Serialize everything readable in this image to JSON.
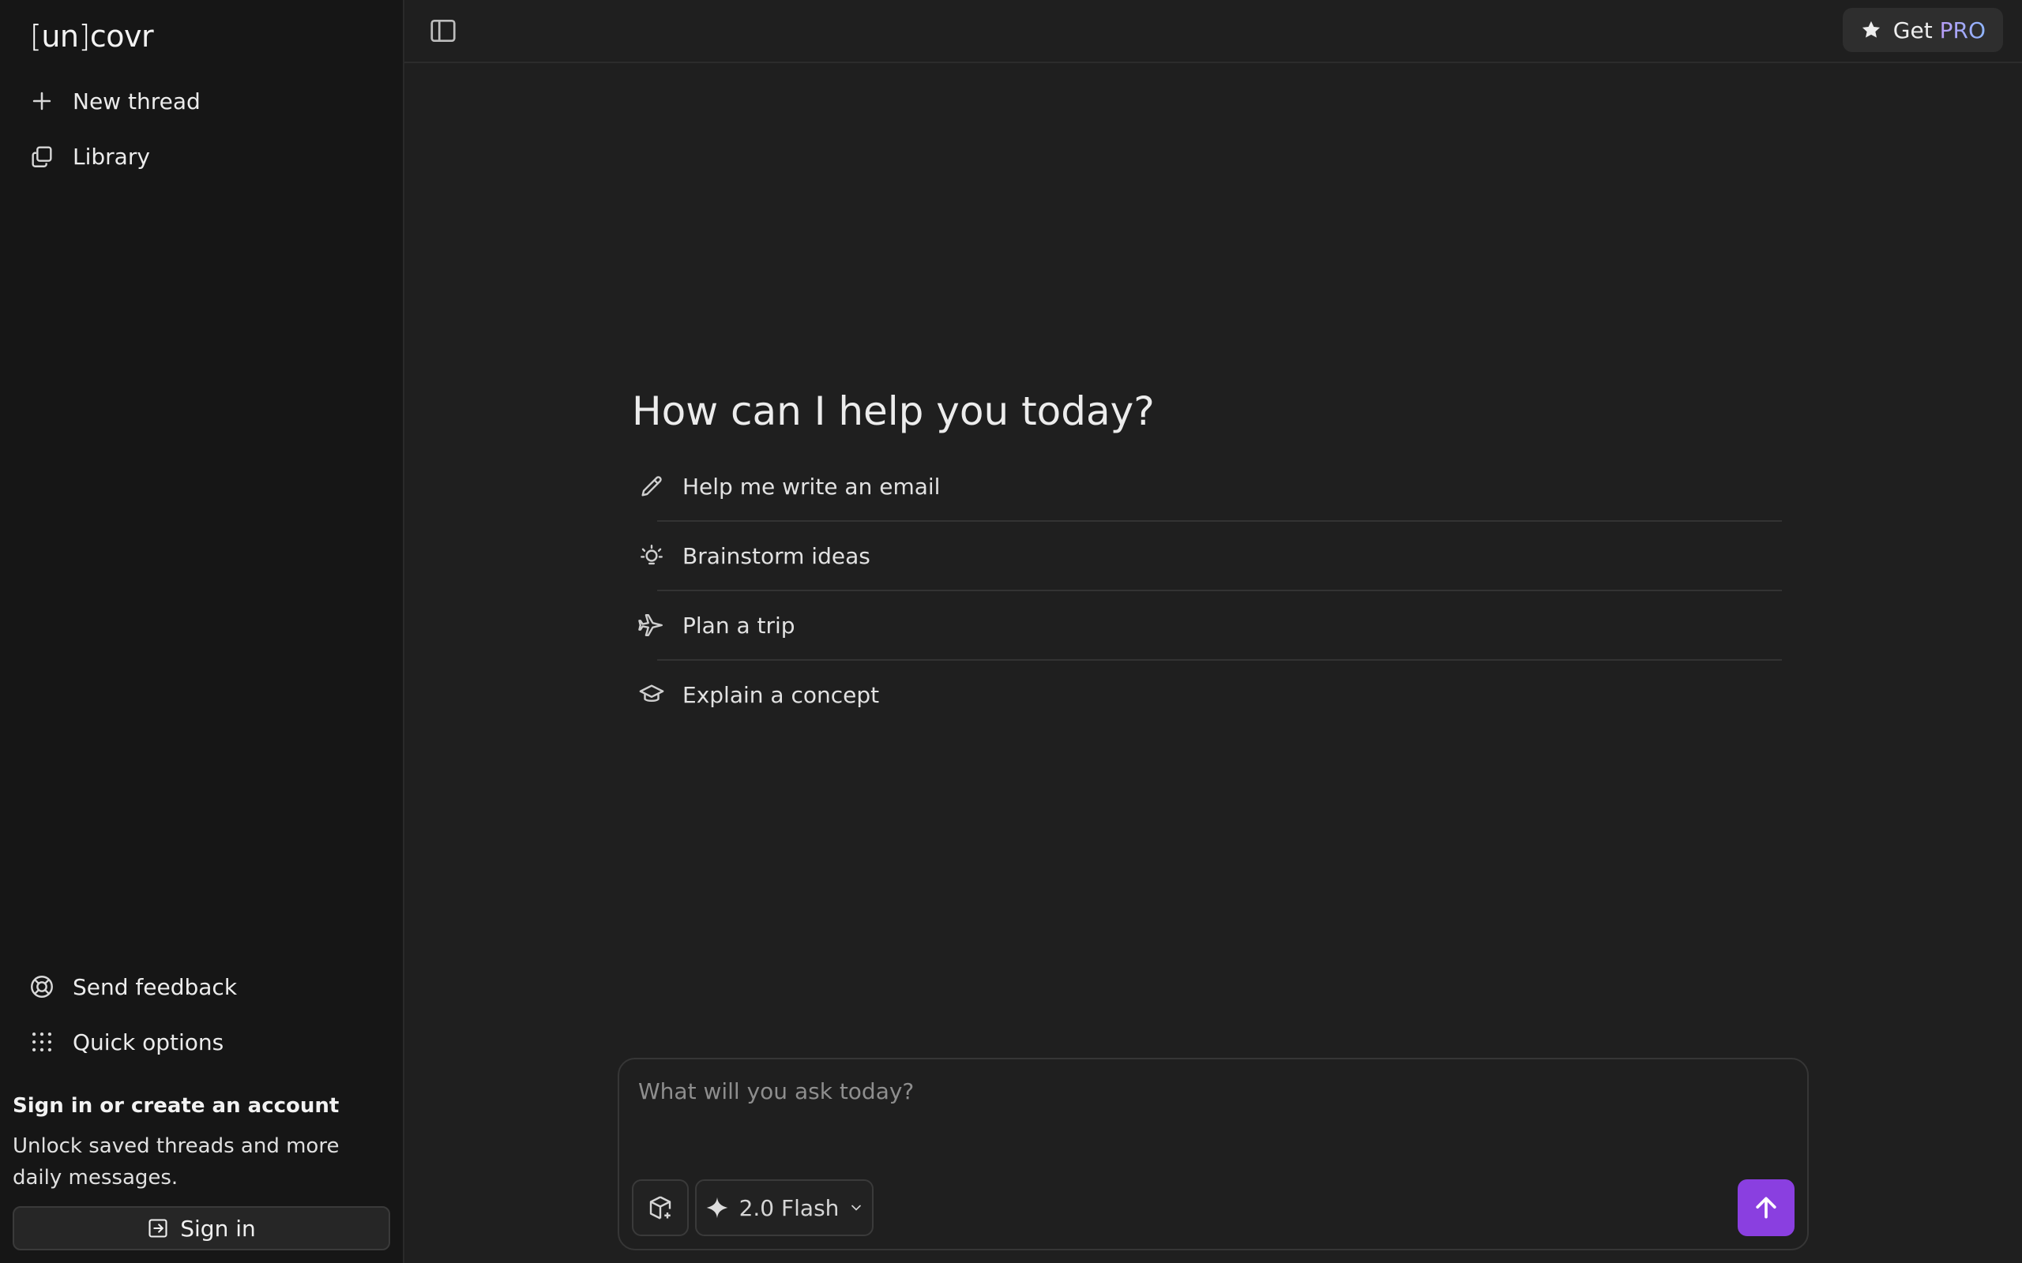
{
  "app": {
    "logo_bracket_open": "[",
    "logo_un": "un",
    "logo_bracket_close": "]",
    "logo_rest": "covr"
  },
  "sidebar": {
    "new_thread": "New thread",
    "library": "Library",
    "send_feedback": "Send feedback",
    "quick_options": "Quick options",
    "promo_title": "Sign in or create an account",
    "promo_text": "Unlock saved threads and more daily messages.",
    "signin_label": "Sign in"
  },
  "header": {
    "get_label": "Get",
    "pro_label": "PRO"
  },
  "main": {
    "greeting": "How can I help you today?",
    "suggestions": [
      {
        "label": "Help me write an email",
        "icon": "pencil-icon"
      },
      {
        "label": "Brainstorm ideas",
        "icon": "lightbulb-icon"
      },
      {
        "label": "Plan a trip",
        "icon": "plane-icon"
      },
      {
        "label": "Explain a concept",
        "icon": "graduation-cap-icon"
      }
    ]
  },
  "composer": {
    "placeholder": "What will you ask today?",
    "model_label": "2.0 Flash"
  },
  "colors": {
    "accent": "#8a3fe0",
    "background": "#1f1f1f",
    "sidebar": "#161616"
  }
}
